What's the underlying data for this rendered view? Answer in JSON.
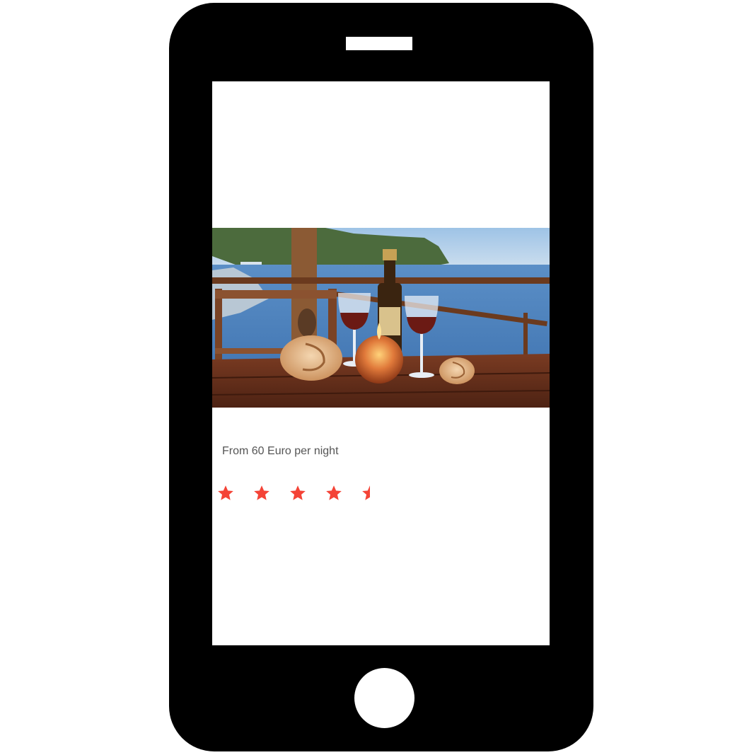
{
  "listing": {
    "price_text": "From 60 Euro per night",
    "rating": {
      "value": 4.5,
      "max": 5,
      "color": "#f44336"
    },
    "photo_alt": "Table with wine, candle and sea shells on a balcony overlooking the sea"
  },
  "colors": {
    "device": "#000000",
    "screen": "#ffffff",
    "text": "#555555"
  },
  "icons": {
    "star": "star-icon",
    "home": "home-button-icon"
  }
}
